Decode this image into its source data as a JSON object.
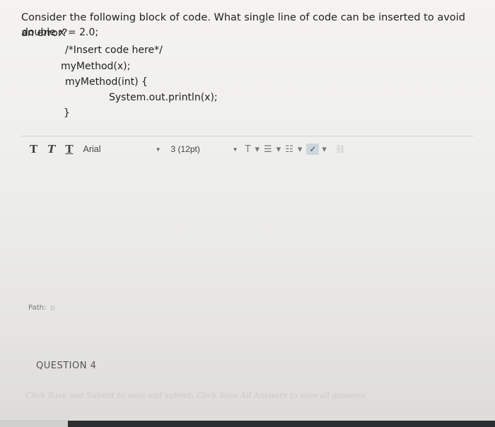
{
  "question": {
    "prompt": "Consider the following block of code. What single line of code can be inserted to avoid an error?",
    "code": [
      "double x = 2.0;",
      "/*Insert code here*/",
      "myMethod(x);",
      "myMethod(int) {",
      "System.out.println(x);",
      "}"
    ]
  },
  "toolbar": {
    "bold_label": "T",
    "italic_label": "T",
    "underline_label": "T",
    "font_family": "Arial",
    "font_size": "3 (12pt)",
    "text_color_label": "T",
    "list_icons": [
      "bulleted-list-icon",
      "numbered-list-icon"
    ],
    "spellcheck_icon": "spellcheck-icon"
  },
  "editor": {
    "path_label": "Path:",
    "path_value": "p"
  },
  "next_question": {
    "label": "QUESTION 4"
  },
  "footer": {
    "note": "Click Save and Submit to save and submit. Click Save All Answers to save all answers."
  }
}
